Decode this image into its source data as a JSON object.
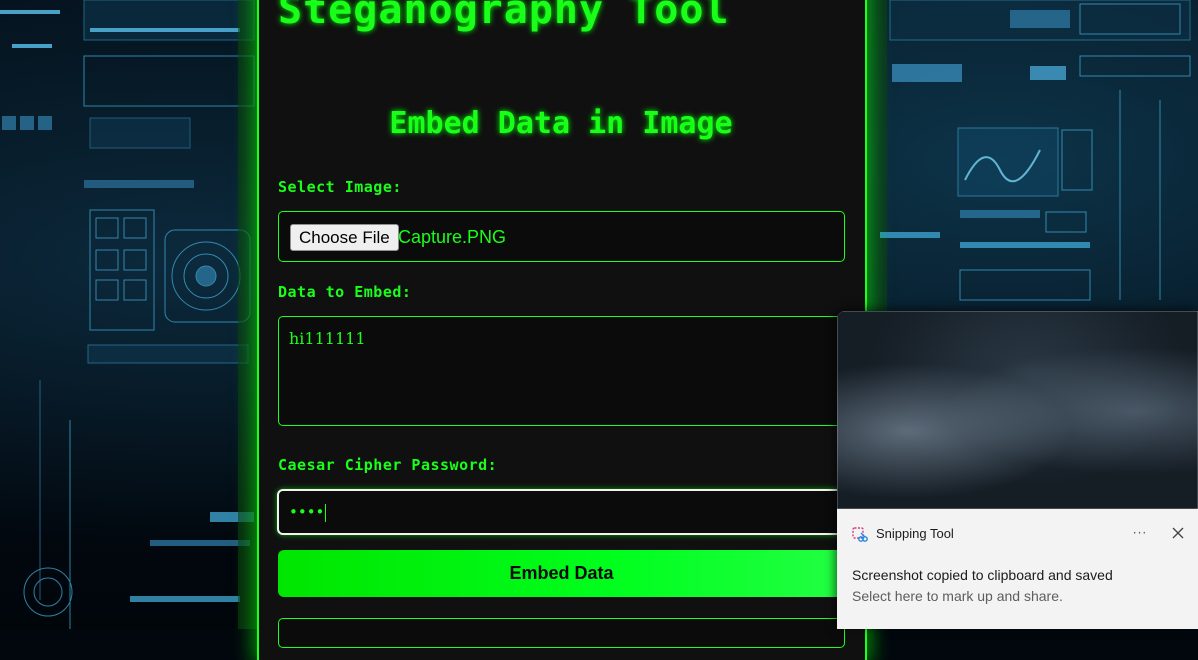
{
  "app": {
    "title": "Steganography Tool",
    "subtitle": "Embed Data in Image"
  },
  "form": {
    "image_label": "Select Image:",
    "file_button": "Choose File",
    "file_name": "Capture.PNG",
    "data_label": "Data to Embed:",
    "data_value": "hi111111",
    "password_label": "Caesar Cipher Password:",
    "password_mask": "••••",
    "submit_label": "Embed Data"
  },
  "toast": {
    "app_name": "Snipping Tool",
    "more_label": "···",
    "message": "Screenshot copied to clipboard and saved",
    "sub_message": "Select here to mark up and share."
  },
  "colors": {
    "accent": "#1aff1a",
    "panel_bg": "#101010",
    "toast_bg": "#f3f3f3"
  }
}
